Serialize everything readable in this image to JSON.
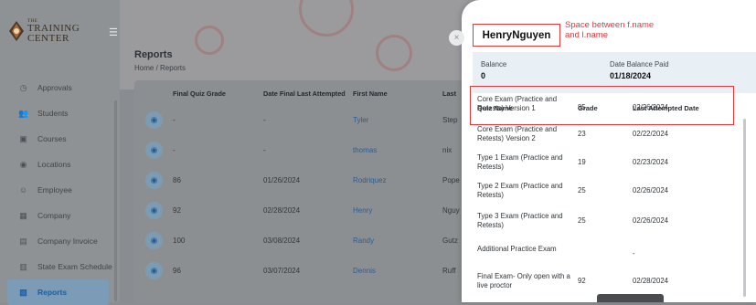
{
  "brand": {
    "line1": "THE",
    "line2": "TRAINING",
    "line3": "CENTER"
  },
  "sidebar": {
    "items": [
      {
        "label": "Approvals",
        "icon": "approvals-icon",
        "glyph": "◷",
        "active": false
      },
      {
        "label": "Students",
        "icon": "students-icon",
        "glyph": "👥",
        "active": false
      },
      {
        "label": "Courses",
        "icon": "courses-icon",
        "glyph": "▣",
        "active": false
      },
      {
        "label": "Locations",
        "icon": "location-pin-icon",
        "glyph": "◉",
        "active": false
      },
      {
        "label": "Employee",
        "icon": "employee-icon",
        "glyph": "☺",
        "active": false
      },
      {
        "label": "Company",
        "icon": "company-icon",
        "glyph": "▦",
        "active": false
      },
      {
        "label": "Company Invoice",
        "icon": "invoice-icon",
        "glyph": "▤",
        "active": false
      },
      {
        "label": "State Exam Schedule",
        "icon": "calendar-icon",
        "glyph": "▥",
        "active": false
      },
      {
        "label": "Reports",
        "icon": "reports-icon",
        "glyph": "▧",
        "active": true
      }
    ]
  },
  "page": {
    "title": "Reports",
    "breadcrumb": "Home / Reports"
  },
  "table": {
    "headers": [
      "Final Quiz Grade",
      "Date Final Last Attempted",
      "First Name",
      "Last"
    ],
    "rows": [
      {
        "grade": "-",
        "date": "-",
        "first": "Tyler",
        "last": "Step"
      },
      {
        "grade": "-",
        "date": "-",
        "first": "thomas",
        "last": "nix"
      },
      {
        "grade": "86",
        "date": "01/26/2024",
        "first": "Rodriquez",
        "last": "Pope"
      },
      {
        "grade": "92",
        "date": "02/28/2024",
        "first": "Henry",
        "last": "Nguy"
      },
      {
        "grade": "100",
        "date": "03/08/2024",
        "first": "Randy",
        "last": "Gutz"
      },
      {
        "grade": "96",
        "date": "03/07/2024",
        "first": "Dennis",
        "last": "Ruff"
      }
    ]
  },
  "modal": {
    "close_glyph": "×",
    "student_name": "HenryNguyen",
    "note": "Space between f.name and l.name",
    "balance_label": "Balance",
    "balance_value": "0",
    "paid_label": "Date Balance Paid",
    "paid_value": "01/18/2024",
    "score_headers": [
      "Quiz Name",
      "Grade",
      "Last Attempted Date"
    ],
    "scores": [
      {
        "name": "Core Exam (Practice and Retests) Version 1",
        "grade": "85",
        "date": "02/26/2024"
      },
      {
        "name": "Core Exam (Practice and Retests) Version 2",
        "grade": "23",
        "date": "02/22/2024"
      },
      {
        "name": "Type 1 Exam (Practice and Retests)",
        "grade": "19",
        "date": "02/23/2024"
      },
      {
        "name": "Type 2 Exam (Practice and Retests)",
        "grade": "25",
        "date": "02/26/2024"
      },
      {
        "name": "Type 3 Exam (Practice and Retests)",
        "grade": "25",
        "date": "02/26/2024"
      },
      {
        "name": "Additional Practice Exam",
        "grade": "",
        "date": "-"
      },
      {
        "name": "Final Exam- Only open with a live proctor",
        "grade": "92",
        "date": "02/28/2024"
      }
    ]
  },
  "colors": {
    "accent": "#1b5ea1",
    "annotation": "#d83c3c",
    "balance_bg": "#e8f0f6"
  }
}
